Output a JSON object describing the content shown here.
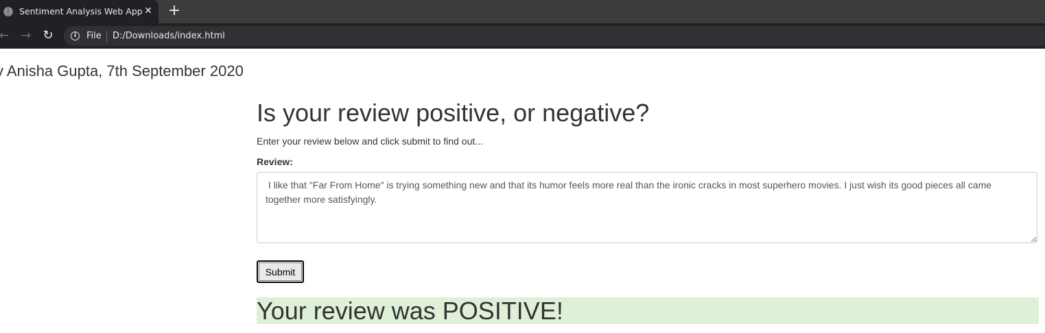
{
  "browser": {
    "tab_title": "Sentiment Analysis Web App",
    "tab_close_glyph": "✕",
    "new_tab_glyph": "+",
    "back_glyph": "←",
    "forward_glyph": "→",
    "reload_glyph": "↻",
    "info_glyph": "i",
    "url_scheme": "File",
    "url": "D:/Downloads/index.html",
    "icons": [
      "globe-icon",
      "close-icon",
      "plus-icon",
      "back-arrow-icon",
      "forward-arrow-icon",
      "reload-icon",
      "info-icon"
    ],
    "colors": {
      "tab_strip": "#3c3c3c",
      "active_tab": "#202124",
      "omnibox": "#303134",
      "text": "#e8eaed"
    }
  },
  "page": {
    "byline": "y Anisha Gupta, 7th September 2020",
    "heading": "Is your review positive, or negative?",
    "intro": "Enter your review below and click submit to find out...",
    "review_label": "Review:",
    "review_text": " I like that \"Far From Home\" is trying something new and that its humor feels more real than the ironic cracks in most superhero movies. I just wish its good pieces all came together more satisfyingly.",
    "submit_label": "Submit",
    "result_text": "Your review was POSITIVE!",
    "colors": {
      "result_background": "#dff0d8",
      "text": "#333333"
    }
  }
}
